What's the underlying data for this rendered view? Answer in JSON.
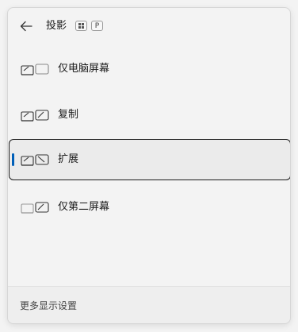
{
  "header": {
    "title": "投影",
    "shortcut_key_p": "P",
    "back_icon": "arrow-left-icon",
    "win_key_icon": "windows-key-icon"
  },
  "options": [
    {
      "label": "仅电脑屏幕",
      "icon": "pc-screen-only-icon",
      "selected": false
    },
    {
      "label": "复制",
      "icon": "duplicate-icon",
      "selected": false
    },
    {
      "label": "扩展",
      "icon": "extend-icon",
      "selected": true
    },
    {
      "label": "仅第二屏幕",
      "icon": "second-screen-only-icon",
      "selected": false
    }
  ],
  "footer": {
    "link_label": "更多显示设置"
  },
  "colors": {
    "accent": "#005fb8",
    "selected_border": "#1b1b1b",
    "background": "#f3f3f3"
  }
}
